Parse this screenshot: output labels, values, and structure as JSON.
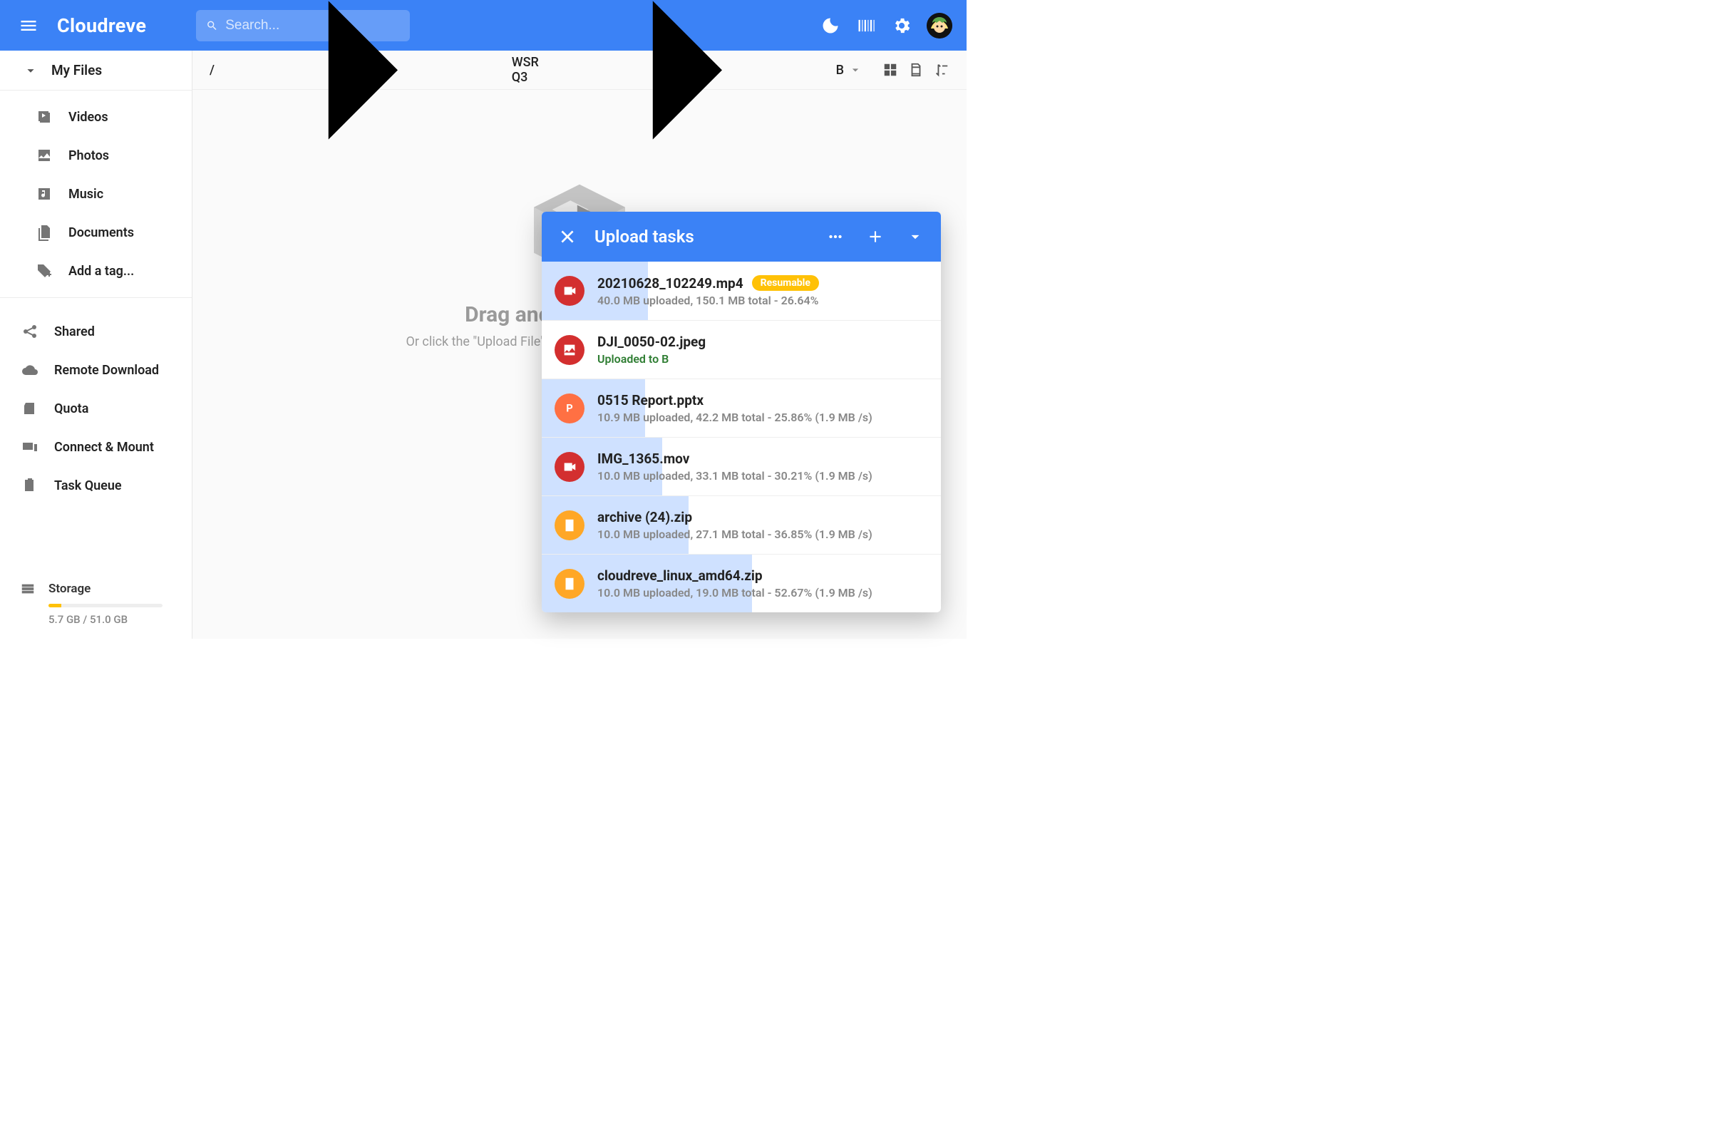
{
  "header": {
    "brand": "Cloudreve",
    "search_placeholder": "Search..."
  },
  "sidebar": {
    "head": "My Files",
    "filters": [
      {
        "id": "videos",
        "label": "Videos"
      },
      {
        "id": "photos",
        "label": "Photos"
      },
      {
        "id": "music",
        "label": "Music"
      },
      {
        "id": "documents",
        "label": "Documents"
      },
      {
        "id": "addtag",
        "label": "Add a tag..."
      }
    ],
    "links": [
      {
        "id": "shared",
        "label": "Shared"
      },
      {
        "id": "remote",
        "label": "Remote Download"
      },
      {
        "id": "quota",
        "label": "Quota"
      },
      {
        "id": "connect",
        "label": "Connect & Mount"
      },
      {
        "id": "taskqueue",
        "label": "Task Queue"
      }
    ],
    "storage": {
      "label": "Storage",
      "text": "5.7 GB / 51.0 GB",
      "percent": 11.2
    }
  },
  "crumbs": {
    "root": "/",
    "mid": "WSR Q3",
    "last": "B"
  },
  "dropzone": {
    "big": "Drag and drop files here",
    "small": "Or click the \"Upload File\" button on the lower right to add files"
  },
  "upload": {
    "title": "Upload tasks",
    "items": [
      {
        "name": "20210628_102249.mp4",
        "sub": "40.0 MB uploaded, 150.1 MB total - 26.64%",
        "progress": 26.64,
        "icon": "video",
        "iconcolor": "red",
        "badge": "Resumable"
      },
      {
        "name": "DJI_0050-02.jpeg",
        "sub": "Uploaded to B",
        "progress": 0,
        "icon": "image",
        "iconcolor": "red",
        "done": true
      },
      {
        "name": "0515 Report.pptx",
        "sub": "10.9 MB uploaded, 42.2 MB total - 25.86% (1.9 MB /s)",
        "progress": 25.86,
        "icon": "p",
        "iconcolor": "orange"
      },
      {
        "name": "IMG_1365.mov",
        "sub": "10.0 MB uploaded, 33.1 MB total - 30.21% (1.9 MB /s)",
        "progress": 30.21,
        "icon": "video",
        "iconcolor": "red"
      },
      {
        "name": "archive (24).zip",
        "sub": "10.0 MB uploaded, 27.1 MB total - 36.85% (1.9 MB /s)",
        "progress": 36.85,
        "icon": "zip",
        "iconcolor": "amber"
      },
      {
        "name": "cloudreve_linux_amd64.zip",
        "sub": "10.0 MB uploaded, 19.0 MB total - 52.67% (1.9 MB /s)",
        "progress": 52.67,
        "icon": "zip",
        "iconcolor": "amber"
      }
    ]
  }
}
